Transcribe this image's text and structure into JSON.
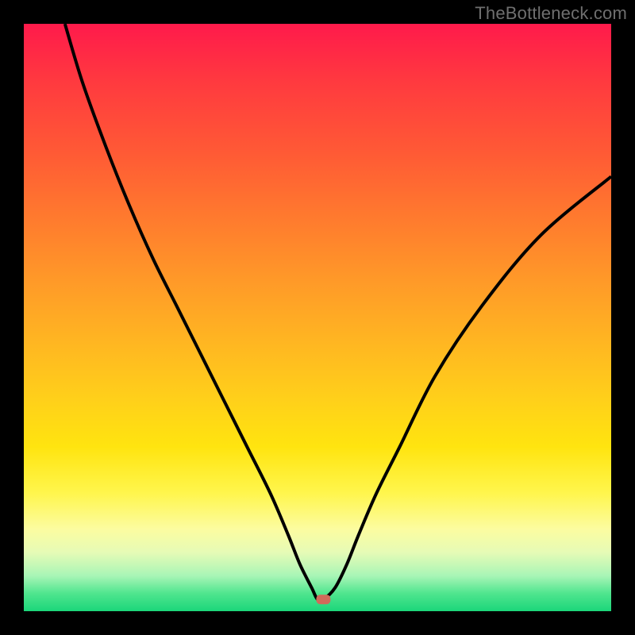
{
  "watermark": "TheBottleneck.com",
  "chart_data": {
    "type": "line",
    "title": "",
    "xlabel": "",
    "ylabel": "",
    "xlim": [
      0,
      100
    ],
    "ylim": [
      0,
      100
    ],
    "grid": false,
    "series": [
      {
        "name": "bottleneck-curve",
        "x": [
          7,
          10,
          14,
          18,
          22,
          26,
          30,
          34,
          38,
          42,
          45,
          47,
          49,
          50,
          51,
          53,
          55,
          57,
          60,
          64,
          70,
          78,
          88,
          100
        ],
        "values": [
          100,
          90,
          79,
          69,
          60,
          52,
          44,
          36,
          28,
          20,
          13,
          8,
          4,
          2,
          2,
          4,
          8,
          13,
          20,
          28,
          40,
          52,
          64,
          74
        ]
      }
    ],
    "marker": {
      "x": 51,
      "y": 2,
      "color": "#d16a5a"
    },
    "colors": {
      "curve": "#000000",
      "page_bg": "#000000",
      "gradient_top": "#ff1a4b",
      "gradient_bottom": "#1bd67a"
    }
  }
}
